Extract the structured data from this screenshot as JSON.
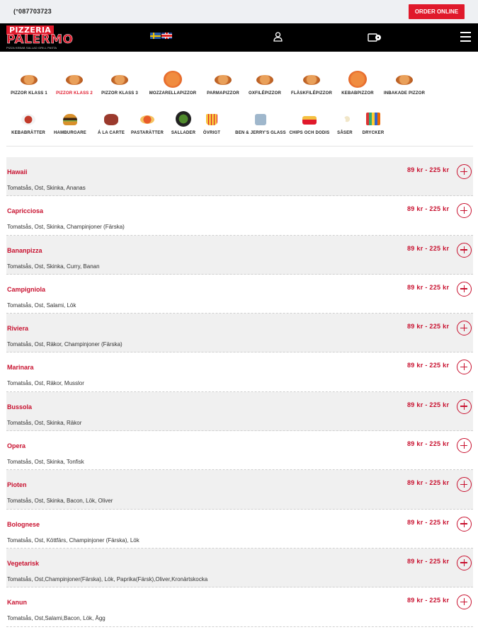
{
  "topbar": {
    "phone": "(°087703723",
    "order_label": "ORDER ONLINE"
  },
  "logo": {
    "line1": "PIZZERIA",
    "line2": "PALERMO",
    "tagline": "PIZZA KEBAB SALLAD GRILL PASTA"
  },
  "nav": {
    "flags": [
      "swedish-flag-icon",
      "uk-flag-icon"
    ],
    "user_icon": "user-icon",
    "cart_icon": "cart-icon",
    "menu_icon": "hamburger-menu-icon"
  },
  "categories": [
    {
      "label": "PIZZOR KLASS 1",
      "icon": "pizza",
      "active": false
    },
    {
      "label": "PIZZOR KLASS 2",
      "icon": "pizza",
      "active": true
    },
    {
      "label": "PIZZOR KLASS 3",
      "icon": "pizza",
      "active": false
    },
    {
      "label": "MOZZARELLAPIZZOR",
      "icon": "pizza-big",
      "active": false
    },
    {
      "label": "PARMAPIZZOR",
      "icon": "pizza",
      "active": false
    },
    {
      "label": "OXFILÉPIZZOR",
      "icon": "pizza",
      "active": false
    },
    {
      "label": "FLÄSKFILÉPIZZOR",
      "icon": "pizza",
      "active": false
    },
    {
      "label": "KEBABPIZZOR",
      "icon": "pizza-big",
      "active": false
    },
    {
      "label": "INBAKADE PIZZOR",
      "icon": "pizza",
      "active": false
    },
    {
      "label": "KEBABRÄTTER",
      "icon": "kebab",
      "active": false
    },
    {
      "label": "HAMBURGARE",
      "icon": "burger",
      "active": false
    },
    {
      "label": "Á LA CARTE",
      "icon": "meat",
      "active": false
    },
    {
      "label": "PASTARÄTTER",
      "icon": "pasta",
      "active": false
    },
    {
      "label": "SALLADER",
      "icon": "salad",
      "active": false
    },
    {
      "label": "ÖVRIGT",
      "icon": "fries",
      "active": false
    },
    {
      "label": "BEN & JERRY'S GLASS",
      "icon": "icecream",
      "active": false
    },
    {
      "label": "CHIPS OCH DODIS",
      "icon": "chips",
      "active": false
    },
    {
      "label": "SÅSER",
      "icon": "sauce",
      "active": false
    },
    {
      "label": "DRYCKER",
      "icon": "drinks",
      "active": false
    }
  ],
  "items": [
    {
      "name": "Hawaii",
      "desc": "Tomatsås, Ost, Skinka, Ananas",
      "price": "89 kr - 225 kr"
    },
    {
      "name": "Capricciosa",
      "desc": "Tomatsås, Ost, Skinka, Champinjoner (Färska)",
      "price": "89 kr - 225 kr"
    },
    {
      "name": "Bananpizza",
      "desc": "Tomatsås, Ost, Skinka, Curry, Banan",
      "price": "89 kr - 225 kr"
    },
    {
      "name": "Campigniola",
      "desc": "Tomatsås, Ost, Salami, Lök",
      "price": "89 kr - 225 kr"
    },
    {
      "name": "Riviera",
      "desc": "Tomatsås, Ost, Räkor, Champinjoner (Färska)",
      "price": "89 kr - 225 kr"
    },
    {
      "name": "Marinara",
      "desc": "Tomatsås, Ost, Räkor, Musslor",
      "price": "89 kr - 225 kr"
    },
    {
      "name": "Bussola",
      "desc": "Tomatsås, Ost, Skinka, Räkor",
      "price": "89 kr - 225 kr"
    },
    {
      "name": "Opera",
      "desc": "Tomatsås, Ost, Skinka, Tonfisk",
      "price": "89 kr - 225 kr"
    },
    {
      "name": "Pioten",
      "desc": "Tomatsås, Ost, Skinka, Bacon, Lök, Oliver",
      "price": "89 kr - 225 kr"
    },
    {
      "name": "Bolognese",
      "desc": "Tomatsås, Ost, Köttfärs, Champinjoner (Färska), Lök",
      "price": "89 kr - 225 kr"
    },
    {
      "name": "Vegetarisk",
      "desc": "Tomatsås, Ost,Champinjoner(Färska), Lök, Paprika(Färsk),Oliver,Kronärtskocka",
      "price": "89 kr - 225 kr"
    },
    {
      "name": "Kanun",
      "desc": "Tomatsås, Ost,Salami,Bacon, Lök, Ägg",
      "price": "89 kr - 225 kr"
    }
  ],
  "colors": {
    "accent": "#c8102e",
    "button": "#e0192b",
    "navbar": "#000000",
    "topbar": "#eef0f3",
    "row_alt": "#f0f0f0"
  }
}
